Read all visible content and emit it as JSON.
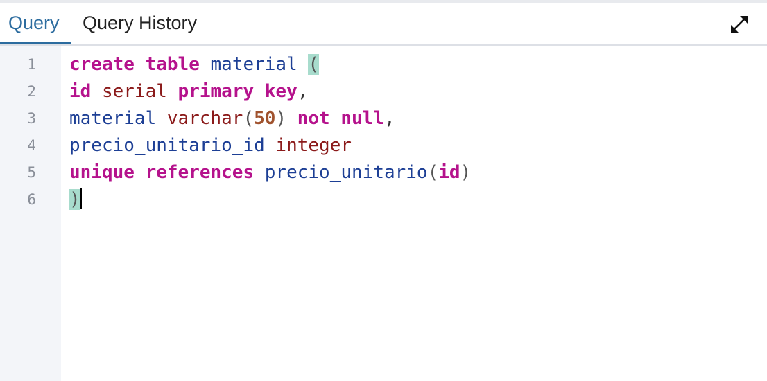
{
  "tabs": {
    "query_label": "Query",
    "history_label": "Query History",
    "active": "Query"
  },
  "toolbar": {
    "expand_icon": "expand-arrows-icon"
  },
  "editor": {
    "line_numbers": [
      "1",
      "2",
      "3",
      "4",
      "5",
      "6"
    ],
    "lines": [
      {
        "tokens": [
          {
            "text": "create",
            "kind": "keyword"
          },
          {
            "text": " ",
            "kind": "space"
          },
          {
            "text": "table",
            "kind": "keyword"
          },
          {
            "text": " ",
            "kind": "space"
          },
          {
            "text": "material",
            "kind": "identifier"
          },
          {
            "text": " ",
            "kind": "space"
          },
          {
            "text": "(",
            "kind": "paren-match"
          }
        ]
      },
      {
        "tokens": [
          {
            "text": "id",
            "kind": "keyword"
          },
          {
            "text": " ",
            "kind": "space"
          },
          {
            "text": "serial",
            "kind": "type"
          },
          {
            "text": " ",
            "kind": "space"
          },
          {
            "text": "primary",
            "kind": "keyword"
          },
          {
            "text": " ",
            "kind": "space"
          },
          {
            "text": "key",
            "kind": "keyword"
          },
          {
            "text": ",",
            "kind": "punct"
          }
        ]
      },
      {
        "tokens": [
          {
            "text": "material",
            "kind": "identifier"
          },
          {
            "text": " ",
            "kind": "space"
          },
          {
            "text": "varchar",
            "kind": "type"
          },
          {
            "text": "(",
            "kind": "paren"
          },
          {
            "text": "50",
            "kind": "number"
          },
          {
            "text": ")",
            "kind": "paren"
          },
          {
            "text": " ",
            "kind": "space"
          },
          {
            "text": "not",
            "kind": "keyword"
          },
          {
            "text": " ",
            "kind": "space"
          },
          {
            "text": "null",
            "kind": "keyword"
          },
          {
            "text": ",",
            "kind": "punct"
          }
        ]
      },
      {
        "tokens": [
          {
            "text": "precio_unitario_id",
            "kind": "identifier"
          },
          {
            "text": " ",
            "kind": "space"
          },
          {
            "text": "integer",
            "kind": "type"
          }
        ]
      },
      {
        "tokens": [
          {
            "text": "unique",
            "kind": "keyword"
          },
          {
            "text": " ",
            "kind": "space"
          },
          {
            "text": "references",
            "kind": "keyword"
          },
          {
            "text": " ",
            "kind": "space"
          },
          {
            "text": "precio_unitario",
            "kind": "identifier"
          },
          {
            "text": "(",
            "kind": "paren"
          },
          {
            "text": "id",
            "kind": "keyword"
          },
          {
            "text": ")",
            "kind": "paren"
          }
        ]
      },
      {
        "tokens": [
          {
            "text": ")",
            "kind": "paren-match"
          }
        ]
      }
    ],
    "cursor_line": 6
  },
  "colors": {
    "active_tab": "#2c6c9f",
    "keyword": "#b5128c",
    "identifier": "#1d3f95",
    "type": "#8b1a1a",
    "number": "#a0522d",
    "bracket_highlight": "#a8dccd",
    "gutter_bg": "#f3f5f9"
  }
}
